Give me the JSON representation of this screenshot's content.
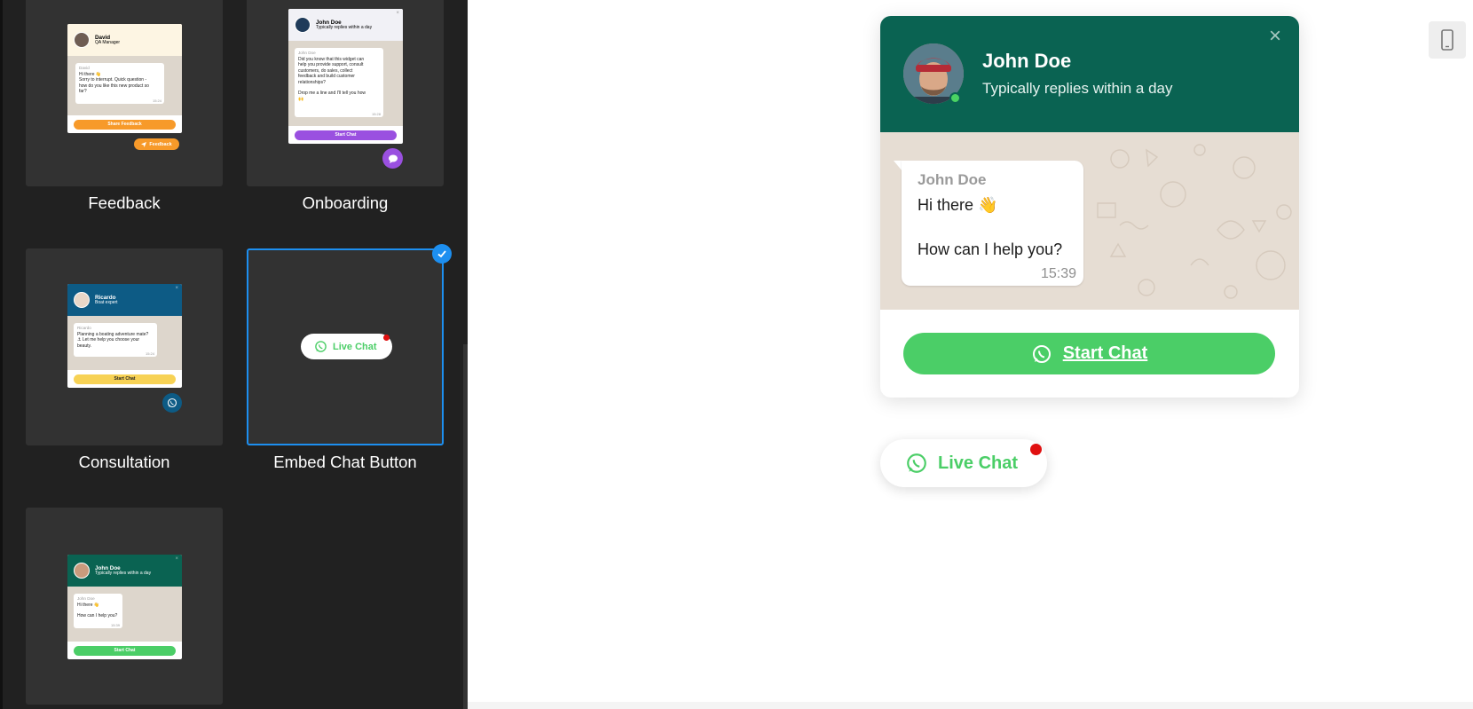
{
  "gallery": {
    "tiles": [
      {
        "label": "Feedback",
        "mini": {
          "name": "David",
          "role": "QA Manager",
          "msg_name": "David",
          "msg_lines": [
            "Hi there 👋",
            "Sorry to interrupt. Quick question -",
            "how do you like this new product so",
            "far?"
          ],
          "time": "15:24",
          "button": "Share Feedback",
          "launcher": "Feedback"
        }
      },
      {
        "label": "Onboarding",
        "mini": {
          "name": "John Doe",
          "role": "Typically replies within a day",
          "msg_name": "John Doe",
          "msg_lines": [
            "Did you know that this widget can",
            "help you provide support, consult",
            "customers, do sales, collect",
            "feedback and build customer",
            "relationships?",
            "",
            "Drop me a line and I'll tell you how",
            "🙌"
          ],
          "time": "15:28",
          "button": "Start Chat"
        }
      },
      {
        "label": "Consultation",
        "mini": {
          "name": "Ricardo",
          "role": "Boat expert",
          "msg_name": "Ricardo",
          "msg_lines": [
            "Planning a boating adventure mate?",
            "⚓ Let me help you choose your",
            "beauty."
          ],
          "time": "15:24",
          "button": "Start Chat"
        }
      },
      {
        "label": "Embed Chat Button",
        "selected": true,
        "preview_label": "Live Chat"
      },
      {
        "label": "",
        "mini": {
          "name": "John Doe",
          "role": "Typically replies within a day",
          "msg_name": "John Doe",
          "msg_lines": [
            "Hi there 👋",
            "",
            "How can I help you?"
          ],
          "time": "15:39",
          "button": "Start Chat"
        }
      }
    ]
  },
  "widget": {
    "name": "John Doe",
    "status": "Typically replies within a day",
    "close_icon": "×",
    "message": {
      "sender": "John Doe",
      "line1": "Hi there 👋",
      "line2": "How can I help you?",
      "time": "15:39"
    },
    "start_button": "Start Chat"
  },
  "live_chat_button": {
    "label": "Live Chat"
  },
  "colors": {
    "header_green": "#0a6352",
    "button_green": "#4bce67",
    "selected_blue": "#1d8ff0",
    "feedback_orange": "#f79a2a",
    "onboarding_purple": "#9a50e0",
    "consultation_blue": "#0d5b85",
    "consultation_yellow": "#f7d255",
    "notification_red": "#e01010"
  },
  "icons": [
    "whatsapp-icon",
    "close-icon",
    "check-icon",
    "mobile-device-icon",
    "send-icon",
    "chat-bubble-icon"
  ]
}
